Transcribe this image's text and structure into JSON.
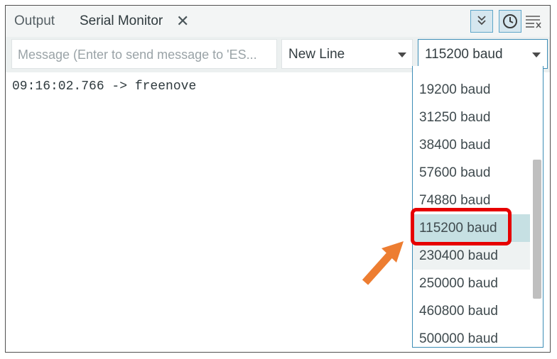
{
  "tabs": {
    "output_label": "Output",
    "serial_label": "Serial Monitor",
    "close_glyph": "✕"
  },
  "toolbar": {
    "autoscroll_icon": "double-chevron-down-icon",
    "timestamp_icon": "clock-icon",
    "clear_icon": "clear-output-icon"
  },
  "input": {
    "message_placeholder": "Message (Enter to send message to 'ES..."
  },
  "line_ending": {
    "selected": "New Line"
  },
  "baud": {
    "selected": "115200 baud",
    "options": [
      "19200 baud",
      "31250 baud",
      "38400 baud",
      "57600 baud",
      "74880 baud",
      "115200 baud",
      "230400 baud",
      "250000 baud",
      "460800 baud",
      "500000 baud"
    ],
    "highlighted_index": 5,
    "hover_index": 6,
    "scroll_position": 0.47
  },
  "output": {
    "line1": "09:16:02.766 -> freenove"
  },
  "colors": {
    "accent": "#3d8db6",
    "selection": "#c6e0e3",
    "annotation_box": "#e60000",
    "annotation_arrow": "#ed7d31"
  }
}
